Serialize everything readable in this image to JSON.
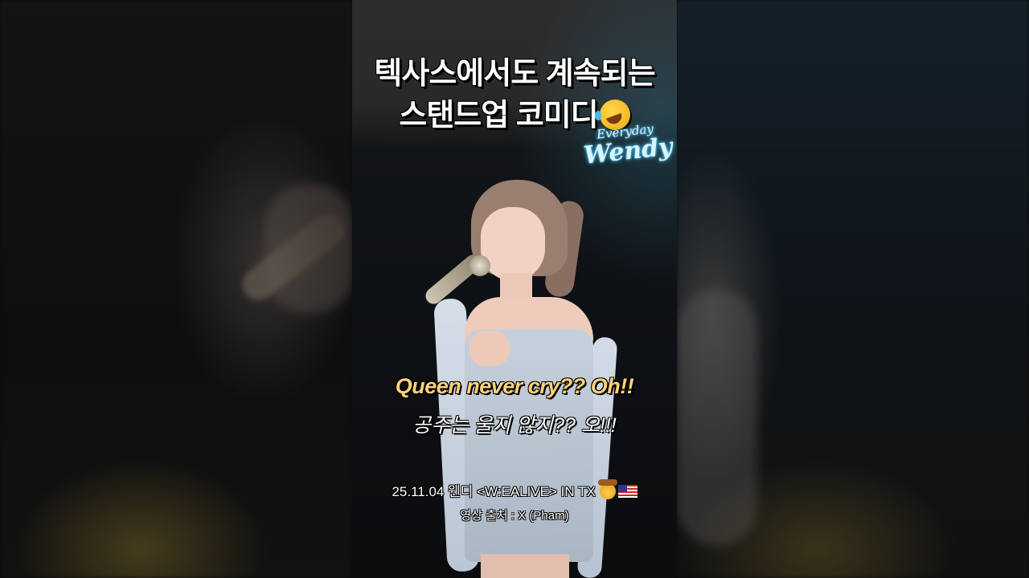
{
  "title": {
    "line1": "텍사스에서도 계속되는",
    "line2": "스탠드업 코미디",
    "line2_emoji": "rolling-on-floor-laughing-emoji"
  },
  "logo": {
    "small": "Everyday",
    "big": "Wendy"
  },
  "subtitle": {
    "english": "Queen never cry?? Oh!!",
    "korean": "공주는 울지 않지?? 오!!!"
  },
  "credit": {
    "event": "25.11.04 웬디 <W:EALIVE> IN TX",
    "emojis": [
      "cowboy-face-emoji",
      "us-flag-emoji"
    ],
    "source": "영상 출처 : X (Pham)"
  },
  "colors": {
    "subtitle_english": "#ffd27a",
    "logo_glow": "#4fd0ff",
    "title_text": "#ffffff"
  }
}
